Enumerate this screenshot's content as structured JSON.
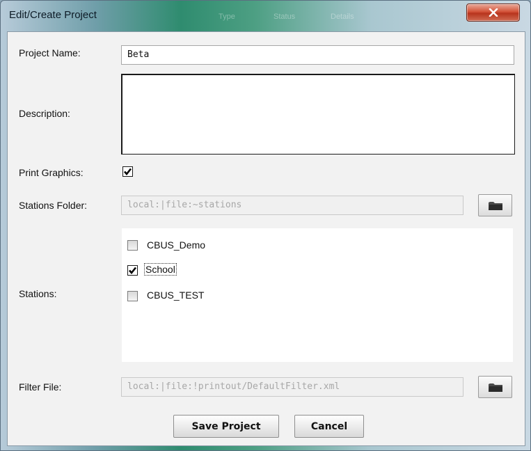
{
  "window": {
    "title": "Edit/Create Project",
    "ghost_menu": [
      "Type",
      "Status",
      "Details"
    ]
  },
  "form": {
    "project_name_label": "Project Name:",
    "project_name_value": "Beta",
    "description_label": "Description:",
    "description_value": "",
    "print_graphics_label": "Print Graphics:",
    "print_graphics_checked": true,
    "stations_folder_label": "Stations Folder:",
    "stations_folder_value": "local:|file:~stations",
    "stations_label": "Stations:",
    "stations": [
      {
        "name": "CBUS_Demo",
        "checked": false
      },
      {
        "name": "School",
        "checked": true
      },
      {
        "name": "CBUS_TEST",
        "checked": false
      }
    ],
    "filter_file_label": "Filter File:",
    "filter_file_value": "local:|file:!printout/DefaultFilter.xml"
  },
  "buttons": {
    "save": "Save Project",
    "cancel": "Cancel"
  },
  "icons": {
    "close": "close-icon",
    "folder": "folder-icon",
    "check": "checkmark-icon"
  }
}
